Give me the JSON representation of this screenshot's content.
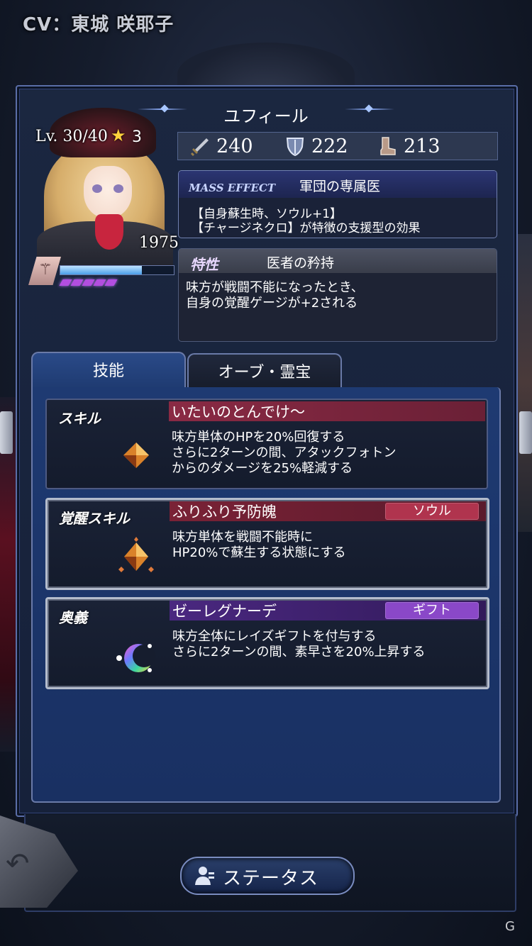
{
  "voice_actor": "CV：東城 咲耶子",
  "character": {
    "name": "ユフィール",
    "level_text": "Lv. 30/40",
    "stars": "3",
    "power": "1975",
    "exp_fraction": 0.72,
    "gauge_segments": 5
  },
  "stats": {
    "attack": "240",
    "defense": "222",
    "speed": "213"
  },
  "mass_effect": {
    "tag": "MASS EFFECT",
    "title": "軍団の専属医",
    "line1": "【自身蘇生時、ソウル+1】",
    "line2": "【チャージネクロ】が特徴の支援型の効果"
  },
  "trait": {
    "tag": "特性",
    "title": "医者の矜持",
    "line1": "味方が戦闘不能になったとき、",
    "line2": "自身の覚醒ゲージが+2される"
  },
  "tabs": {
    "active": "技能",
    "inactive": "オーブ・霊宝"
  },
  "skills": [
    {
      "label": "スキル",
      "title": "いたいのとんでけ〜",
      "badge": "",
      "line1": "味方単体のHPを20%回復する",
      "line2": "さらに2ターンの間、アタックフォトン",
      "line3": "からのダメージを25%軽減する"
    },
    {
      "label": "覚醒スキル",
      "title": "ふりふり予防魄",
      "badge": "ソウル",
      "line1": "味方単体を戦闘不能時に",
      "line2": "HP20%で蘇生する状態にする",
      "line3": ""
    },
    {
      "label": "奥義",
      "title": "ゼーレグナーデ",
      "badge": "ギフト",
      "line1": "味方全体にレイズギフトを付与する",
      "line2": "さらに2ターンの間、素早さを20%上昇する",
      "line3": ""
    }
  ],
  "status_button": "ステータス",
  "colors": {
    "skill_bar": "#8a2a44",
    "awaken_bar": "#7a2236",
    "soul_badge": "#b0344e",
    "ougi_bar": "#4a2880",
    "gift_badge": "#8a48c8"
  }
}
